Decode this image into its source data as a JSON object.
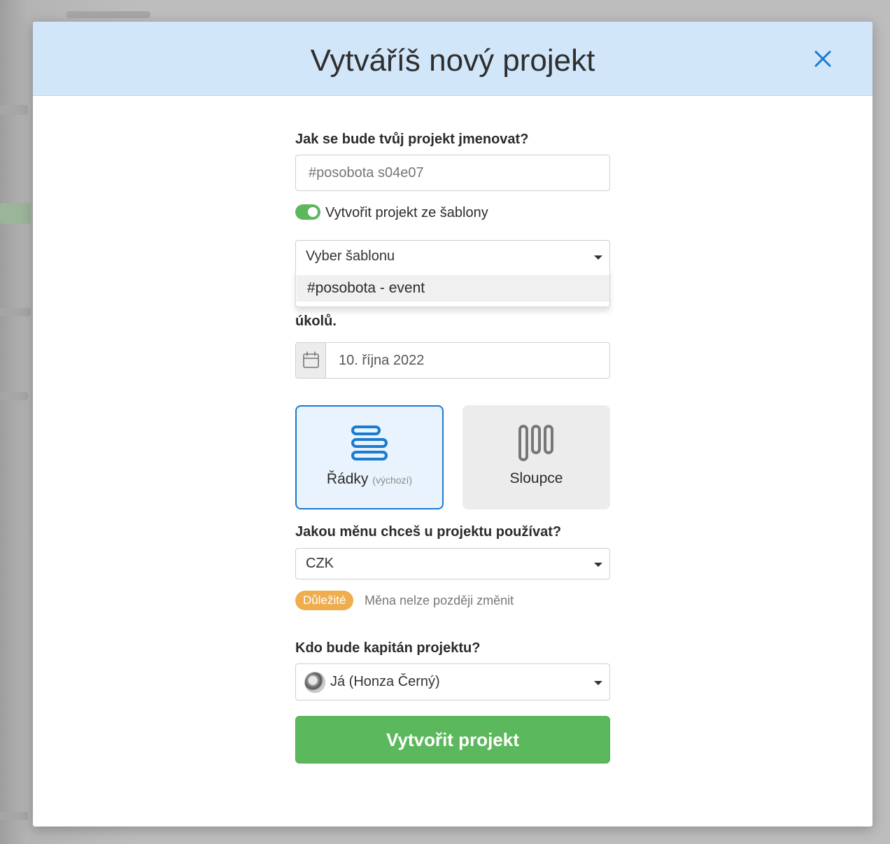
{
  "modal": {
    "title": "Vytváříš nový projekt",
    "close_icon": "close-icon"
  },
  "project_name": {
    "label": "Jak se bude tvůj projekt jmenovat?",
    "placeholder": "#posobota s04e07"
  },
  "template_toggle": {
    "label": "Vytvořit projekt ze šablony",
    "checked": true
  },
  "template_select": {
    "value": "Vyber šablonu",
    "options": [
      "#posobota - event"
    ]
  },
  "date": {
    "label_partial": "úkolů.",
    "value": "10. října 2022",
    "icon": "calendar-icon"
  },
  "layout": {
    "rows_label": "Řádky",
    "rows_sub": "(výchozí)",
    "rows_icon": "rows-icon",
    "columns_label": "Sloupce",
    "columns_icon": "columns-icon",
    "selected": "rows"
  },
  "currency": {
    "label": "Jakou měnu chceš u projektu používat?",
    "value": "CZK",
    "badge": "Důležité",
    "hint": "Měna nelze později změnit"
  },
  "captain": {
    "label": "Kdo bude kapitán projektu?",
    "value": "Já (Honza Černý)"
  },
  "submit": {
    "label": "Vytvořit projekt"
  },
  "colors": {
    "header_bg": "#d1e6f9",
    "accent_blue": "#1a7bd0",
    "success_green": "#5cb85c",
    "warning_orange": "#f0ad4e"
  }
}
